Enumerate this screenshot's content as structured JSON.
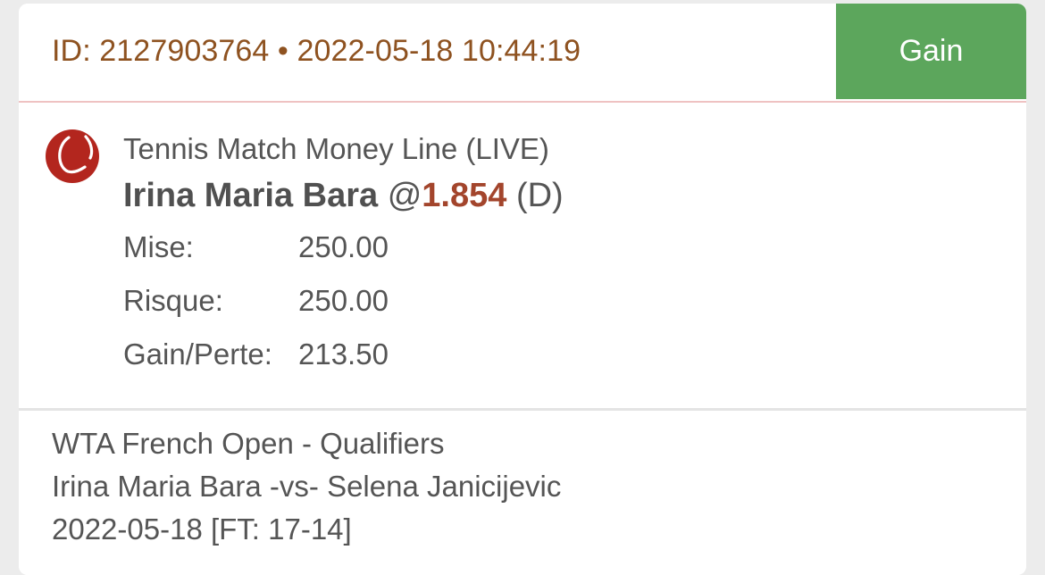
{
  "header": {
    "id_text": "ID: 2127903764 • 2022-05-18 10:44:19",
    "status_label": "Gain",
    "status_color": "#5ca65c"
  },
  "bet": {
    "sport_icon": "tennis-ball-icon",
    "market": "Tennis Match Money Line (LIVE)",
    "selection": "Irina Maria Bara",
    "at_symbol": "@",
    "odds": "1.854",
    "odds_type": "(D)",
    "details": [
      {
        "label": "Mise:",
        "value": "250.00"
      },
      {
        "label": "Risque:",
        "value": "250.00"
      },
      {
        "label": "Gain/Perte:",
        "value": "213.50"
      }
    ]
  },
  "event": {
    "competition": "WTA French Open - Qualifiers",
    "matchup": "Irina Maria Bara -vs- Selena Janicijevic",
    "result": "2022-05-18 [FT: 17-14]"
  },
  "colors": {
    "accent_odds": "#a3452c",
    "header_text": "#8e5220",
    "icon_red": "#b3261e"
  }
}
